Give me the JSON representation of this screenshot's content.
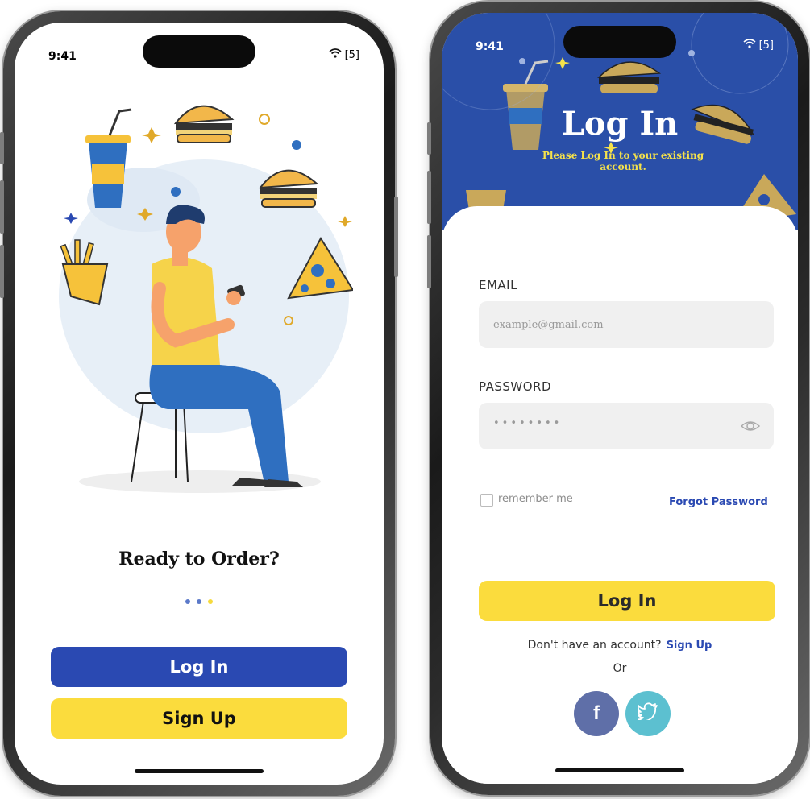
{
  "status": {
    "time": "9:41",
    "battery": "[5]"
  },
  "welcome": {
    "title": "Ready to Order?",
    "dots_colors": [
      "#5b79c9",
      "#5b79c9",
      "#f6da3d"
    ],
    "login_button": "Log In",
    "signup_button": "Sign Up"
  },
  "login": {
    "title": "Log In",
    "subtitle": "Please Log In to your existing account.",
    "email_label": "EMAIL",
    "email_placeholder": "example@gmail.com",
    "password_label": "PASSWORD",
    "password_value": "••••••••",
    "remember_label": "remember me",
    "forgot_label": "Forgot Password",
    "login_button": "Log In",
    "no_account_text": "Don't have an account?",
    "signup_link": "Sign Up",
    "or_text": "Or",
    "social": {
      "facebook": "f"
    }
  },
  "colors": {
    "primary": "#2a49b2",
    "accent": "#fbdc3d",
    "header_bg": "#2a4fa8",
    "facebook": "#5f6fa8",
    "twitter": "#5cc0d0"
  },
  "icons": [
    "wifi-icon",
    "battery-icon",
    "eye-icon",
    "facebook-icon",
    "twitter-icon",
    "burger-icon",
    "drink-icon",
    "fries-icon",
    "pizza-icon"
  ]
}
